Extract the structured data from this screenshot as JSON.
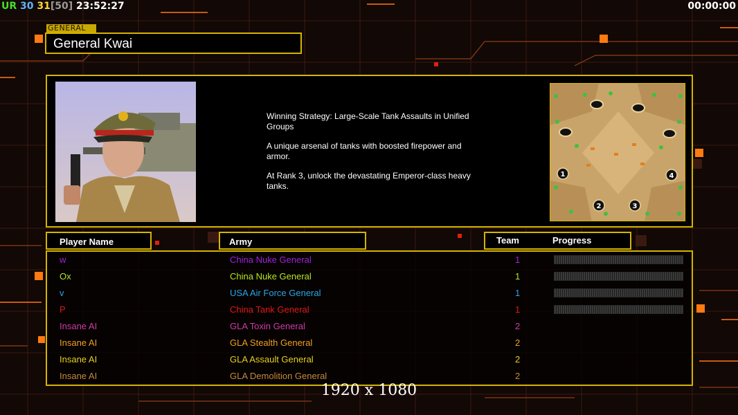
{
  "hud": {
    "ur": "UR",
    "fps": "30",
    "fps_current": "31",
    "fps_limit": "[50]",
    "time_of_day": "23:52:27",
    "game_timer": "00:00:00"
  },
  "general": {
    "tag": "GENERAL",
    "name": "General Kwai",
    "description": [
      "Winning Strategy: Large-Scale Tank Assaults in Unified\n Groups",
      "A unique arsenal of tanks with boosted firepower and\n armor.",
      "At Rank 3, unlock the devastating Emperor-class heavy\n tanks."
    ]
  },
  "map": {
    "start_positions": [
      "1",
      "2",
      "3",
      "4"
    ]
  },
  "columns": {
    "player_name": "Player Name",
    "army": "Army",
    "team": "Team",
    "progress": "Progress"
  },
  "players": [
    {
      "name": "w",
      "army": "China Nuke General",
      "team": "1",
      "color": "#a020e0",
      "progress_bar": true
    },
    {
      "name": "Ox",
      "army": "China Nuke General",
      "team": "1",
      "color": "#b8e81a",
      "progress_bar": true
    },
    {
      "name": "v",
      "army": "USA Air Force General",
      "team": "1",
      "color": "#2aa6e8",
      "progress_bar": true
    },
    {
      "name": "P",
      "army": "China Tank General",
      "team": "1",
      "color": "#e01818",
      "progress_bar": true
    },
    {
      "name": "Insane AI",
      "army": "GLA Toxin General",
      "team": "2",
      "color": "#d03aa8",
      "progress_bar": false
    },
    {
      "name": "Insane AI",
      "army": "GLA Stealth General",
      "team": "2",
      "color": "#f0a020",
      "progress_bar": false
    },
    {
      "name": "Insane AI",
      "army": "GLA Assault General",
      "team": "2",
      "color": "#e8d020",
      "progress_bar": false
    },
    {
      "name": "Insane AI",
      "army": "GLA Demolition General",
      "team": "2",
      "color": "#c48a3c",
      "progress_bar": false
    }
  ],
  "resolution_label": "1920 x 1080",
  "colors": {
    "frame": "#d6b400",
    "accent_orange": "#ff7a1a"
  }
}
